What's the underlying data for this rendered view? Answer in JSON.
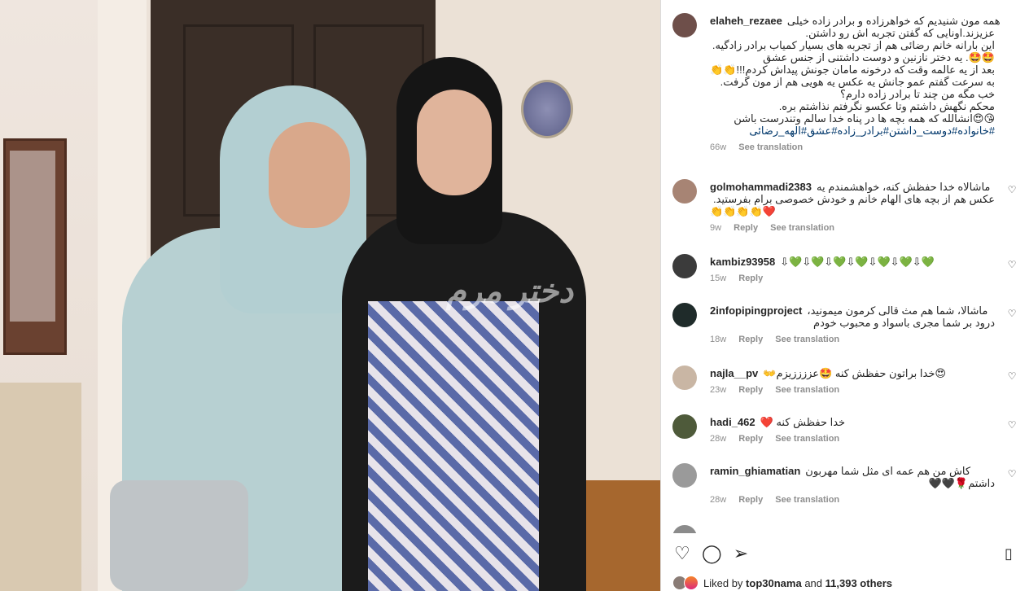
{
  "post": {
    "author": "elaheh_rezaee",
    "caption_lines": [
      "همه مون شنیدیم که خواهرزاده و برادر زاده خیلی",
      "عزیزند.اونایی که گفتن تجربه اش رو داشتن.",
      "این بارانه خانم رضائی هم از تجربه های بسیار کمیاب برادر زادگیه.",
      "🤩🤩. یه دختر نازنین و دوست داشتنی از جنس عشق",
      "بعد از یه عالمه وقت که درخونه مامان جونش پیداش کردم!!!👏👏",
      "به سرعت گفتم عمو جانش یه عکس یه هویی هم از مون گرفت.",
      "خب مگه من چند تا برادر زاده دارم؟",
      "محکم نگهش داشتم وتا عکسو نگرفتم نذاشتم بره.",
      "😘😍انشالله که همه بچه ها در پناه خدا سالم وتندرست باشن"
    ],
    "hashtags": "#خانواده#دوست_داشتن#برادر_زاده#عشق#الهه_رضائی",
    "time": "66w",
    "see_translation": "See translation"
  },
  "comments": [
    {
      "username": "golmohammadi2383",
      "lines": [
        "ماشالاه خدا حفظش کنه، خواهشمندم یه",
        "عکس هم از بچه های الهام خانم و خودش خصوصی برام بفرستید.",
        "👏👏👏👏❤️"
      ],
      "time": "9w",
      "reply": "Reply",
      "see_translation": "See translation"
    },
    {
      "username": "kambiz93958",
      "lines": [
        "⇩💚⇩💚⇩💚⇩💚⇩💚⇩💚⇩💚"
      ],
      "time": "15w",
      "reply": "Reply",
      "see_translation": ""
    },
    {
      "username": "2infopipingproject",
      "lines": [
        "ماشالا، شما هم مث قالی کرمون میمونید،",
        "درود بر شما مجری باسواد و محبوب خودم"
      ],
      "time": "18w",
      "reply": "Reply",
      "see_translation": "See translation"
    },
    {
      "username": "najla__pv",
      "lines": [
        "😍خدا براتون حفظش کنه 🤩عززززیزم👐"
      ],
      "time": "23w",
      "reply": "Reply",
      "see_translation": "See translation"
    },
    {
      "username": "hadi_462",
      "lines": [
        "خدا حفظش کنه ❤️"
      ],
      "time": "28w",
      "reply": "Reply",
      "see_translation": "See translation"
    },
    {
      "username": "ramin_ghiamatian",
      "lines": [
        "کاش من هم عمه ای مثل شما مهربون",
        "داشتم🌹🖤🖤"
      ],
      "time": "28w",
      "reply": "Reply",
      "see_translation": "See translation"
    }
  ],
  "photo": {
    "watermark": "دختر مرم"
  },
  "actions": {
    "like_icon": "heart-outline-icon",
    "comment_icon": "comment-icon",
    "share_icon": "send-icon",
    "save_icon": "bookmark-icon"
  },
  "likes": {
    "prefix": "Liked by",
    "user": "top30nama",
    "middle": "and",
    "count": "11,393 others"
  }
}
